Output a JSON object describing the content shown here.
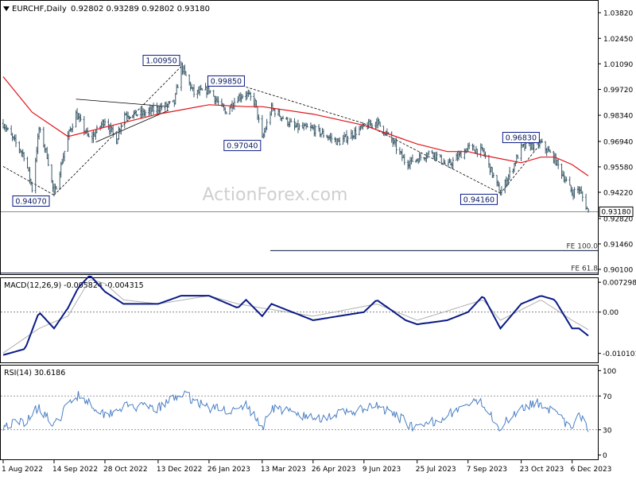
{
  "header": {
    "symbol": "EURCHF,Daily",
    "ohlc": "0.92802 0.93289 0.92802 0.93180"
  },
  "watermark": "ActionForex.com",
  "colors": {
    "bars": "#3c5a69",
    "ma": "#e0141b",
    "macd_line": "#0a1a86",
    "macd_signal": "#b0b0b0",
    "rsi": "#4a7fc4",
    "label_border": "#0a1a86",
    "frame": "#000000",
    "dash_line": "#000000"
  },
  "chart_data": [
    {
      "id": "price",
      "type": "candlestick",
      "ylim": [
        0.898,
        1.045
      ],
      "ticks": [
        "1.03820",
        "1.02450",
        "1.01090",
        "0.99720",
        "0.98340",
        "0.96940",
        "0.95580",
        "0.94220",
        "0.92820",
        "0.91460",
        "0.90100"
      ],
      "current_price": "0.93180",
      "price_points": [
        [
          "1 Aug 2022",
          0.979
        ],
        [
          "8 Aug 2022",
          0.972
        ],
        [
          "20 Aug 2022",
          0.961
        ],
        [
          "26 Aug 2022",
          0.944
        ],
        [
          "1 Sep 2022",
          0.976
        ],
        [
          "8 Sep 2022",
          0.962
        ],
        [
          "14 Sep 2022",
          0.9407
        ],
        [
          "26 Sep 2022",
          0.972
        ],
        [
          "3 Oct 2022",
          0.984
        ],
        [
          "15 Oct 2022",
          0.97
        ],
        [
          "28 Oct 2022",
          0.981
        ],
        [
          "7 Nov 2022",
          0.97
        ],
        [
          "13 Nov 2022",
          0.984
        ],
        [
          "28 Nov 2022",
          0.984
        ],
        [
          "13 Dec 2022",
          0.987
        ],
        [
          "27 Dec 2022",
          0.99
        ],
        [
          "2 Jan 2023",
          1.0095
        ],
        [
          "13 Jan 2023",
          0.995
        ],
        [
          "26 Jan 2023",
          0.997
        ],
        [
          "9 Feb 2023",
          0.985
        ],
        [
          "20 Feb 2023",
          0.993
        ],
        [
          "27 Feb 2023",
          0.995
        ],
        [
          "7 Mar 2023",
          0.99
        ],
        [
          "13 Mar 2023",
          0.9704
        ],
        [
          "21 Mar 2023",
          0.987
        ],
        [
          "10 Apr 2023",
          0.977
        ],
        [
          "26 Apr 2023",
          0.976
        ],
        [
          "18 May 2023",
          0.969
        ],
        [
          "9 Jun 2023",
          0.977
        ],
        [
          "20 Jun 2023",
          0.98
        ],
        [
          "3 Jul 2023",
          0.97
        ],
        [
          "15 Jul 2023",
          0.958
        ],
        [
          "25 Jul 2023",
          0.96
        ],
        [
          "7 Aug 2023",
          0.964
        ],
        [
          "20 Aug 2023",
          0.956
        ],
        [
          "7 Sep 2023",
          0.966
        ],
        [
          "20 Sep 2023",
          0.964
        ],
        [
          "5 Oct 2023",
          0.9416
        ],
        [
          "16 Oct 2023",
          0.956
        ],
        [
          "23 Oct 2023",
          0.966
        ],
        [
          "9 Nov 2023",
          0.9683
        ],
        [
          "21 Nov 2023",
          0.96
        ],
        [
          "6 Dec 2023",
          0.942
        ],
        [
          "12 Dec 2023",
          0.944
        ],
        [
          "20 Dec 2023",
          0.9318
        ]
      ],
      "ma_points": [
        [
          "1 Aug 2022",
          1.004
        ],
        [
          "26 Aug 2022",
          0.985
        ],
        [
          "26 Sep 2022",
          0.972
        ],
        [
          "28 Oct 2022",
          0.977
        ],
        [
          "13 Dec 2022",
          0.984
        ],
        [
          "26 Jan 2023",
          0.989
        ],
        [
          "28 Feb 2023",
          0.988
        ],
        [
          "13 Mar 2023",
          0.988
        ],
        [
          "26 Apr 2023",
          0.984
        ],
        [
          "9 Jun 2023",
          0.978
        ],
        [
          "25 Jul 2023",
          0.968
        ],
        [
          "20 Aug 2023",
          0.964
        ],
        [
          "7 Sep 2023",
          0.964
        ],
        [
          "20 Sep 2023",
          0.962
        ],
        [
          "23 Oct 2023",
          0.958
        ],
        [
          "9 Nov 2023",
          0.961
        ],
        [
          "21 Nov 2023",
          0.961
        ],
        [
          "6 Dec 2023",
          0.957
        ],
        [
          "20 Dec 2023",
          0.951
        ]
      ],
      "labels": [
        {
          "text": "1.00950",
          "date": "2 Jan 2023",
          "value": 1.0095
        },
        {
          "text": "0.99850",
          "date": "27 Feb 2023",
          "value": 0.9985
        },
        {
          "text": "0.97040",
          "date": "13 Mar 2023",
          "value": 0.9704
        },
        {
          "text": "0.94070",
          "date": "14 Sep 2022",
          "value": 0.9407
        },
        {
          "text": "0.96830",
          "date": "9 Nov 2023",
          "value": 0.9683
        },
        {
          "text": "0.94160",
          "date": "5 Oct 2023",
          "value": 0.9416
        }
      ],
      "fe_levels": [
        {
          "text": "FE 100.0",
          "value": 0.911
        },
        {
          "text": "FE 61.8",
          "value": 0.899
        }
      ]
    },
    {
      "id": "macd",
      "type": "line",
      "label": "MACD(12,26,9) -0.005824 -0.004315",
      "ylim": [
        -0.0125,
        0.0083
      ],
      "ticks": [
        "0.007298",
        "0.00",
        "-0.010101"
      ],
      "macd_points": [
        [
          "1 Aug 2022",
          -0.0105
        ],
        [
          "20 Aug 2022",
          -0.009
        ],
        [
          "1 Sep 2022",
          0.0
        ],
        [
          "14 Sep 2022",
          -0.004
        ],
        [
          "26 Sep 2022",
          0.001
        ],
        [
          "5 Oct 2022",
          0.006
        ],
        [
          "15 Oct 2022",
          0.009
        ],
        [
          "28 Oct 2022",
          0.005
        ],
        [
          "13 Nov 2022",
          0.002
        ],
        [
          "13 Dec 2022",
          0.002
        ],
        [
          "2 Jan 2023",
          0.004
        ],
        [
          "26 Jan 2023",
          0.004
        ],
        [
          "20 Feb 2023",
          0.001
        ],
        [
          "27 Feb 2023",
          0.003
        ],
        [
          "13 Mar 2023",
          -0.001
        ],
        [
          "21 Mar 2023",
          0.002
        ],
        [
          "26 Apr 2023",
          -0.002
        ],
        [
          "9 Jun 2023",
          0.0
        ],
        [
          "20 Jun 2023",
          0.003
        ],
        [
          "15 Jul 2023",
          -0.002
        ],
        [
          "25 Jul 2023",
          -0.003
        ],
        [
          "20 Aug 2023",
          -0.002
        ],
        [
          "7 Sep 2023",
          0.0
        ],
        [
          "20 Sep 2023",
          0.004
        ],
        [
          "5 Oct 2023",
          -0.004
        ],
        [
          "23 Oct 2023",
          0.002
        ],
        [
          "9 Nov 2023",
          0.004
        ],
        [
          "21 Nov 2023",
          0.003
        ],
        [
          "6 Dec 2023",
          -0.004
        ],
        [
          "12 Dec 2023",
          -0.004
        ],
        [
          "20 Dec 2023",
          -0.0058
        ]
      ],
      "signal_points": [
        [
          "1 Aug 2022",
          -0.01
        ],
        [
          "1 Sep 2022",
          -0.004
        ],
        [
          "26 Sep 2022",
          -0.001
        ],
        [
          "15 Oct 2022",
          0.008
        ],
        [
          "28 Oct 2022",
          0.007
        ],
        [
          "13 Nov 2022",
          0.003
        ],
        [
          "13 Dec 2022",
          0.002
        ],
        [
          "26 Jan 2023",
          0.004
        ],
        [
          "20 Feb 2023",
          0.002
        ],
        [
          "13 Mar 2023",
          0.001
        ],
        [
          "26 Apr 2023",
          -0.001
        ],
        [
          "20 Jun 2023",
          0.002
        ],
        [
          "25 Jul 2023",
          -0.002
        ],
        [
          "20 Sep 2023",
          0.003
        ],
        [
          "5 Oct 2023",
          -0.002
        ],
        [
          "9 Nov 2023",
          0.003
        ],
        [
          "6 Dec 2023",
          -0.002
        ],
        [
          "20 Dec 2023",
          -0.0043
        ]
      ]
    },
    {
      "id": "rsi",
      "type": "line",
      "label": "RSI(14) 30.6186",
      "ylim": [
        -6,
        106
      ],
      "ticks": [
        "100",
        "70",
        "30",
        "0"
      ],
      "levels": [
        70,
        30
      ],
      "points": [
        [
          "1 Aug 2022",
          35
        ],
        [
          "20 Aug 2022",
          40
        ],
        [
          "1 Sep 2022",
          58
        ],
        [
          "14 Sep 2022",
          33
        ],
        [
          "26 Sep 2022",
          60
        ],
        [
          "5 Oct 2022",
          72
        ],
        [
          "28 Oct 2022",
          48
        ],
        [
          "13 Nov 2022",
          58
        ],
        [
          "13 Dec 2022",
          55
        ],
        [
          "2 Jan 2023",
          73
        ],
        [
          "26 Jan 2023",
          56
        ],
        [
          "20 Feb 2023",
          52
        ],
        [
          "27 Feb 2023",
          60
        ],
        [
          "13 Mar 2023",
          32
        ],
        [
          "21 Mar 2023",
          57
        ],
        [
          "26 Apr 2023",
          43
        ],
        [
          "9 Jun 2023",
          54
        ],
        [
          "20 Jun 2023",
          58
        ],
        [
          "15 Jul 2023",
          40
        ],
        [
          "25 Jul 2023",
          30
        ],
        [
          "20 Aug 2023",
          48
        ],
        [
          "7 Sep 2023",
          60
        ],
        [
          "20 Sep 2023",
          62
        ],
        [
          "5 Oct 2023",
          32
        ],
        [
          "23 Oct 2023",
          58
        ],
        [
          "9 Nov 2023",
          62
        ],
        [
          "21 Nov 2023",
          50
        ],
        [
          "6 Dec 2023",
          30
        ],
        [
          "12 Dec 2023",
          47
        ],
        [
          "20 Dec 2023",
          31
        ]
      ]
    }
  ],
  "x_axis": {
    "dates": [
      "1 Aug 2022",
      "14 Sep 2022",
      "28 Oct 2022",
      "13 Dec 2022",
      "26 Jan 2023",
      "13 Mar 2023",
      "26 Apr 2023",
      "9 Jun 2023",
      "25 Jul 2023",
      "7 Sep 2023",
      "23 Oct 2023",
      "6 Dec 2023"
    ]
  }
}
